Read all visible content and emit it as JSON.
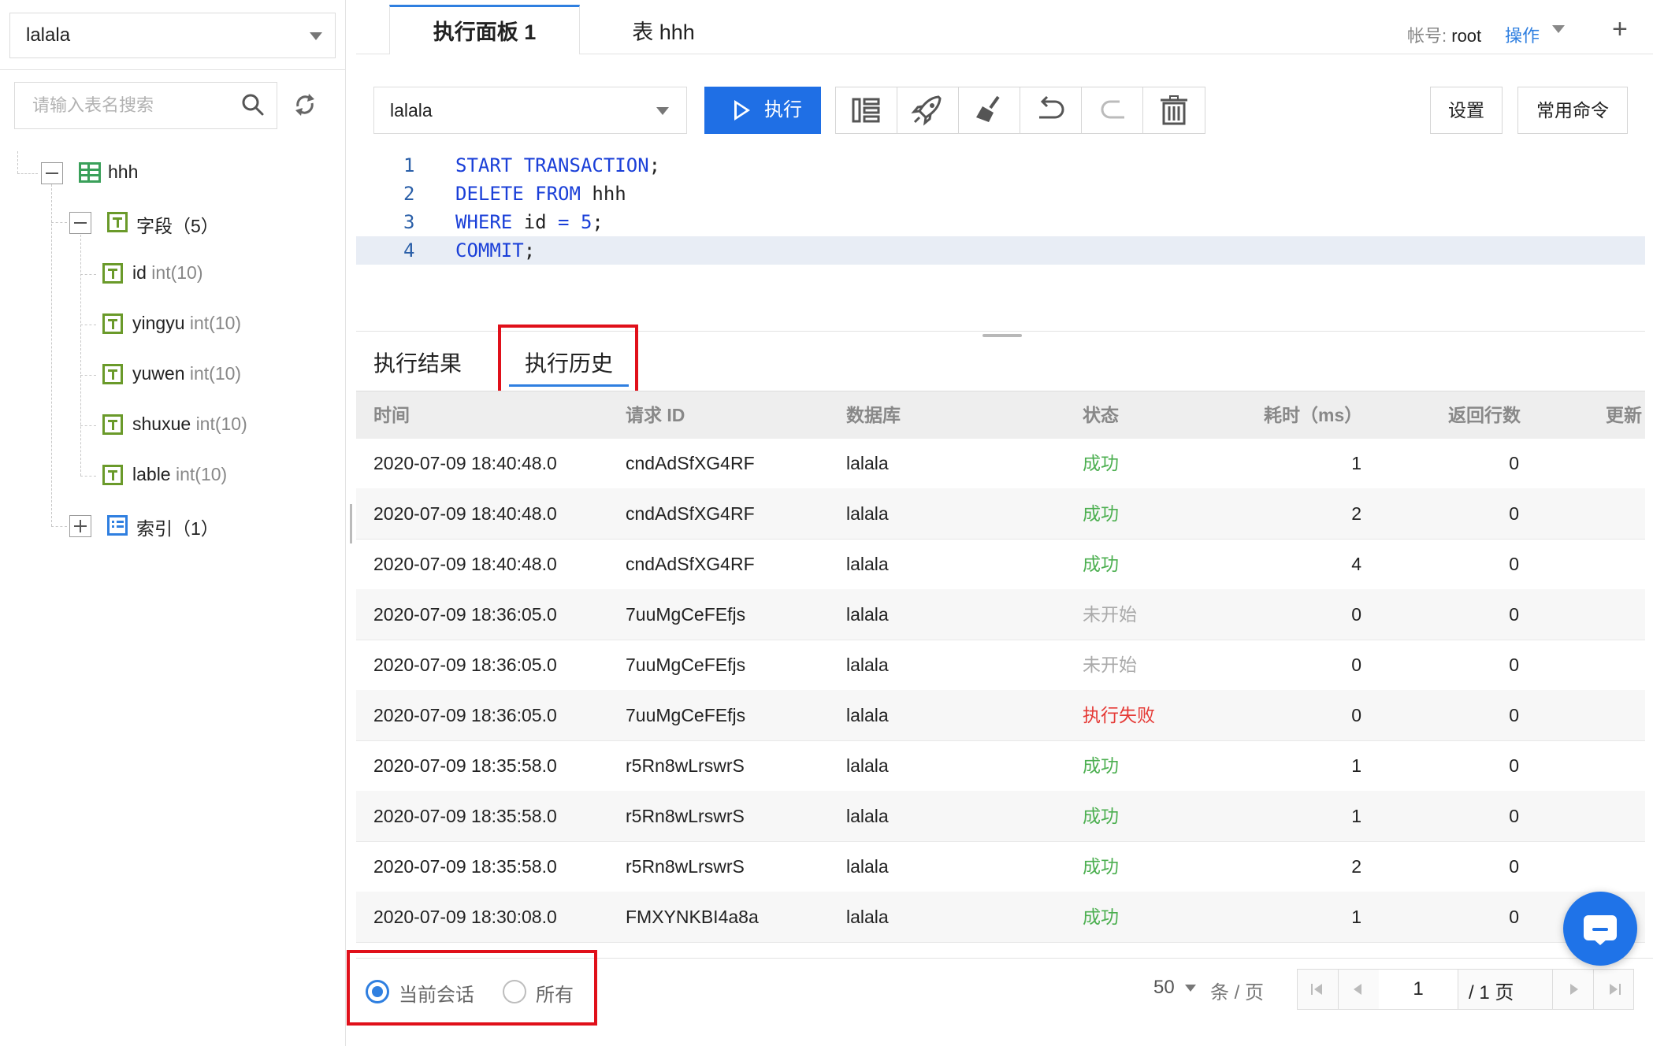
{
  "left_panel": {
    "db_select": "lalala",
    "search_placeholder": "请输入表名搜索",
    "tree": {
      "table_name": "hhh",
      "fields_label": "字段（5）",
      "fields": [
        {
          "name": "id",
          "type": "int(10)"
        },
        {
          "name": "yingyu",
          "type": "int(10)"
        },
        {
          "name": "yuwen",
          "type": "int(10)"
        },
        {
          "name": "shuxue",
          "type": "int(10)"
        },
        {
          "name": "lable",
          "type": "int(10)"
        }
      ],
      "index_label": "索引（1）"
    }
  },
  "tabs": {
    "panel": "执行面板 1",
    "table": "表 hhh",
    "account_label": "帐号:",
    "account_value": "root",
    "operation": "操作",
    "add": "+"
  },
  "toolbar": {
    "db_select": "lalala",
    "run_label": "执行",
    "settings_label": "设置",
    "common_commands_label": "常用命令"
  },
  "editor": {
    "lines": [
      {
        "no": "1",
        "tokens": [
          {
            "t": "START",
            "k": "kw"
          },
          {
            "t": " "
          },
          {
            "t": "TRANSACTION",
            "k": "kw"
          },
          {
            "t": ";"
          }
        ]
      },
      {
        "no": "2",
        "tokens": [
          {
            "t": "DELETE",
            "k": "kw"
          },
          {
            "t": " "
          },
          {
            "t": "FROM",
            "k": "kw"
          },
          {
            "t": " hhh"
          }
        ]
      },
      {
        "no": "3",
        "tokens": [
          {
            "t": "WHERE",
            "k": "kw"
          },
          {
            "t": " id "
          },
          {
            "t": "=",
            "k": "kw"
          },
          {
            "t": " "
          },
          {
            "t": "5",
            "k": "num"
          },
          {
            "t": ";"
          }
        ]
      },
      {
        "no": "4",
        "tokens": [
          {
            "t": "COMMIT",
            "k": "kw"
          },
          {
            "t": ";"
          }
        ]
      }
    ]
  },
  "result_tabs": {
    "results": "执行结果",
    "history": "执行历史"
  },
  "history_table": {
    "headers": [
      "时间",
      "请求 ID",
      "数据库",
      "状态",
      "耗时（ms）",
      "返回行数",
      "更新"
    ],
    "rows": [
      {
        "time": "2020-07-09 18:40:48.0",
        "request_id": "cndAdSfXG4RF",
        "db": "lalala",
        "status": "成功",
        "status_type": "success",
        "cost": "1",
        "rows": "0"
      },
      {
        "time": "2020-07-09 18:40:48.0",
        "request_id": "cndAdSfXG4RF",
        "db": "lalala",
        "status": "成功",
        "status_type": "success",
        "cost": "2",
        "rows": "0"
      },
      {
        "time": "2020-07-09 18:40:48.0",
        "request_id": "cndAdSfXG4RF",
        "db": "lalala",
        "status": "成功",
        "status_type": "success",
        "cost": "4",
        "rows": "0"
      },
      {
        "time": "2020-07-09 18:36:05.0",
        "request_id": "7uuMgCeFEfjs",
        "db": "lalala",
        "status": "未开始",
        "status_type": "pending",
        "cost": "0",
        "rows": "0"
      },
      {
        "time": "2020-07-09 18:36:05.0",
        "request_id": "7uuMgCeFEfjs",
        "db": "lalala",
        "status": "未开始",
        "status_type": "pending",
        "cost": "0",
        "rows": "0"
      },
      {
        "time": "2020-07-09 18:36:05.0",
        "request_id": "7uuMgCeFEfjs",
        "db": "lalala",
        "status": "执行失败",
        "status_type": "failed",
        "cost": "0",
        "rows": "0"
      },
      {
        "time": "2020-07-09 18:35:58.0",
        "request_id": "r5Rn8wLrswrS",
        "db": "lalala",
        "status": "成功",
        "status_type": "success",
        "cost": "1",
        "rows": "0"
      },
      {
        "time": "2020-07-09 18:35:58.0",
        "request_id": "r5Rn8wLrswrS",
        "db": "lalala",
        "status": "成功",
        "status_type": "success",
        "cost": "1",
        "rows": "0"
      },
      {
        "time": "2020-07-09 18:35:58.0",
        "request_id": "r5Rn8wLrswrS",
        "db": "lalala",
        "status": "成功",
        "status_type": "success",
        "cost": "2",
        "rows": "0"
      },
      {
        "time": "2020-07-09 18:30:08.0",
        "request_id": "FMXYNKBI4a8a",
        "db": "lalala",
        "status": "成功",
        "status_type": "success",
        "cost": "1",
        "rows": "0"
      }
    ]
  },
  "footer": {
    "scope_current": "当前会话",
    "scope_all": "所有",
    "selected_scope": "current",
    "page_size": "50",
    "per_page_label": "条 / 页",
    "page_input": "1",
    "page_total": "/ 1 页"
  },
  "colors": {
    "accent": "#2f7fe0",
    "success": "#4caf50",
    "pending": "#aaaaaa",
    "failed": "#e53935",
    "highlight_box": "#e0101a"
  }
}
